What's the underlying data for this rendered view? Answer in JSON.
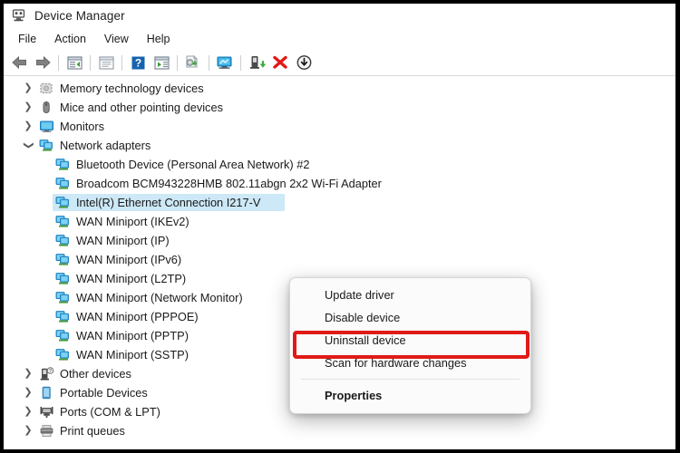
{
  "window": {
    "title": "Device Manager",
    "app_icon": "device-manager-icon"
  },
  "menubar": {
    "items": [
      {
        "label": "File",
        "name": "menu-file"
      },
      {
        "label": "Action",
        "name": "menu-action"
      },
      {
        "label": "View",
        "name": "menu-view"
      },
      {
        "label": "Help",
        "name": "menu-help"
      }
    ]
  },
  "toolbar": {
    "buttons": [
      {
        "icon": "back-arrow-icon",
        "name": "toolbar-back"
      },
      {
        "icon": "forward-arrow-icon",
        "name": "toolbar-forward"
      },
      {
        "icon": "show-hide-console-tree-icon",
        "name": "toolbar-console-tree"
      },
      {
        "icon": "properties-window-icon",
        "name": "toolbar-properties"
      },
      {
        "icon": "help-question-icon",
        "name": "toolbar-help"
      },
      {
        "icon": "show-hide-action-pane-icon",
        "name": "toolbar-action-pane"
      },
      {
        "icon": "update-driver-icon",
        "name": "toolbar-update-driver"
      },
      {
        "icon": "scan-hardware-changes-icon",
        "name": "toolbar-scan-hardware"
      },
      {
        "icon": "enable-device-icon",
        "name": "toolbar-enable-device"
      },
      {
        "icon": "uninstall-device-icon",
        "name": "toolbar-uninstall-device"
      },
      {
        "icon": "disable-device-icon",
        "name": "toolbar-disable-device"
      }
    ]
  },
  "tree": {
    "rows": [
      {
        "label": "Memory technology devices",
        "level": 1,
        "chevron": "collapsed",
        "icon": "memory-card-icon",
        "selected": false
      },
      {
        "label": "Mice and other pointing devices",
        "level": 1,
        "chevron": "collapsed",
        "icon": "mouse-icon",
        "selected": false
      },
      {
        "label": "Monitors",
        "level": 1,
        "chevron": "collapsed",
        "icon": "monitor-icon",
        "selected": false
      },
      {
        "label": "Network adapters",
        "level": 1,
        "chevron": "expanded",
        "icon": "network-adapter-icon",
        "selected": false
      },
      {
        "label": "Bluetooth Device (Personal Area Network) #2",
        "level": 2,
        "chevron": "none",
        "icon": "network-adapter-icon",
        "selected": false
      },
      {
        "label": "Broadcom BCM943228HMB 802.11abgn 2x2 Wi-Fi Adapter",
        "level": 2,
        "chevron": "none",
        "icon": "network-adapter-icon",
        "selected": false
      },
      {
        "label": "Intel(R) Ethernet Connection I217-V",
        "level": 2,
        "chevron": "none",
        "icon": "network-adapter-icon",
        "selected": true
      },
      {
        "label": "WAN Miniport (IKEv2)",
        "level": 2,
        "chevron": "none",
        "icon": "network-adapter-icon",
        "selected": false
      },
      {
        "label": "WAN Miniport (IP)",
        "level": 2,
        "chevron": "none",
        "icon": "network-adapter-icon",
        "selected": false
      },
      {
        "label": "WAN Miniport (IPv6)",
        "level": 2,
        "chevron": "none",
        "icon": "network-adapter-icon",
        "selected": false
      },
      {
        "label": "WAN Miniport (L2TP)",
        "level": 2,
        "chevron": "none",
        "icon": "network-adapter-icon",
        "selected": false
      },
      {
        "label": "WAN Miniport (Network Monitor)",
        "level": 2,
        "chevron": "none",
        "icon": "network-adapter-icon",
        "selected": false
      },
      {
        "label": "WAN Miniport (PPPOE)",
        "level": 2,
        "chevron": "none",
        "icon": "network-adapter-icon",
        "selected": false
      },
      {
        "label": "WAN Miniport (PPTP)",
        "level": 2,
        "chevron": "none",
        "icon": "network-adapter-icon",
        "selected": false
      },
      {
        "label": "WAN Miniport (SSTP)",
        "level": 2,
        "chevron": "none",
        "icon": "network-adapter-icon",
        "selected": false
      },
      {
        "label": "Other devices",
        "level": 1,
        "chevron": "collapsed",
        "icon": "unknown-device-icon",
        "selected": false
      },
      {
        "label": "Portable Devices",
        "level": 1,
        "chevron": "collapsed",
        "icon": "portable-device-icon",
        "selected": false
      },
      {
        "label": "Ports (COM & LPT)",
        "level": 1,
        "chevron": "collapsed",
        "icon": "port-icon",
        "selected": false
      },
      {
        "label": "Print queues",
        "level": 1,
        "chevron": "collapsed",
        "icon": "printer-icon",
        "selected": false
      }
    ]
  },
  "context_menu": {
    "items": [
      {
        "label": "Update driver",
        "bold": false,
        "separator_after": false,
        "highlighted": false
      },
      {
        "label": "Disable device",
        "bold": false,
        "separator_after": false,
        "highlighted": false
      },
      {
        "label": "Uninstall device",
        "bold": false,
        "separator_after": false,
        "highlighted": true
      },
      {
        "label": "Scan for hardware changes",
        "bold": false,
        "separator_after": true,
        "highlighted": false
      },
      {
        "label": "Properties",
        "bold": true,
        "separator_after": false,
        "highlighted": false
      }
    ],
    "highlight_color": "#e01a16"
  },
  "colors": {
    "selection": "#cde8f6",
    "accent_red": "#e01a16",
    "window_border": "#000000"
  }
}
